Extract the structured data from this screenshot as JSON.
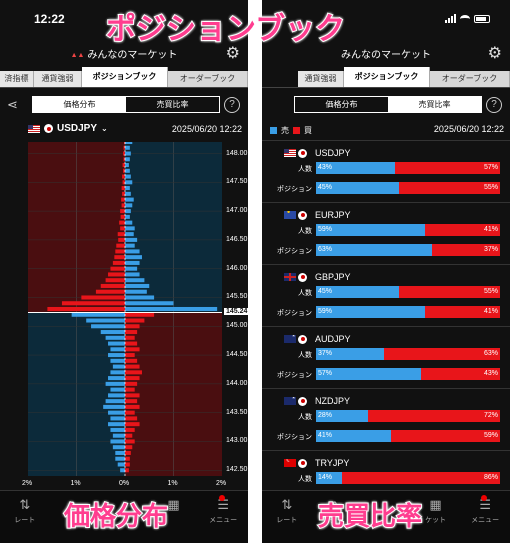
{
  "overlay": {
    "title": "ポジションブック",
    "price_dist": "価格分布",
    "ratio": "売買比率"
  },
  "status": {
    "time": "12:22"
  },
  "app": {
    "title": "みんなのマーケット",
    "icon": "gear-icon"
  },
  "tabs": {
    "left": [
      "済指標",
      "通貨強弱",
      "ポジションブック",
      "オーダーブック"
    ],
    "right": [
      "通貨強弱",
      "ポジションブック",
      "オーダーブック"
    ],
    "active": "ポジションブック"
  },
  "segment": {
    "price": "価格分布",
    "ratio": "売買比率"
  },
  "help": "?",
  "price_view": {
    "pair": "USDJPY",
    "timestamp": "2025/06/20 12:22",
    "current_price": "145.24",
    "x_ticks": [
      "2%",
      "1%",
      "0%",
      "1%",
      "2%"
    ]
  },
  "ratio_view": {
    "timestamp": "2025/06/20 12:22",
    "legend_sell": "売",
    "legend_buy": "買",
    "row_people": "人数",
    "row_position": "ポジション",
    "pairs": [
      {
        "name": "USDJPY",
        "flags": [
          "us",
          "jp"
        ],
        "people": [
          43,
          57
        ],
        "position": [
          45,
          55
        ],
        "people_text": [
          "43%",
          "57%"
        ],
        "position_text": [
          "45%",
          "55%"
        ]
      },
      {
        "name": "EURJPY",
        "flags": [
          "eu",
          "jp"
        ],
        "people": [
          59,
          41
        ],
        "position": [
          63,
          37
        ],
        "people_text": [
          "59%",
          "41%"
        ],
        "position_text": [
          "63%",
          "37%"
        ]
      },
      {
        "name": "GBPJPY",
        "flags": [
          "gb",
          "jp"
        ],
        "people": [
          45,
          55
        ],
        "position": [
          59,
          41
        ],
        "people_text": [
          "45%",
          "55%"
        ],
        "position_text": [
          "59%",
          "41%"
        ]
      },
      {
        "name": "AUDJPY",
        "flags": [
          "au",
          "jp"
        ],
        "people": [
          37,
          63
        ],
        "position": [
          57,
          43
        ],
        "people_text": [
          "37%",
          "63%"
        ],
        "position_text": [
          "57%",
          "43%"
        ]
      },
      {
        "name": "NZDJPY",
        "flags": [
          "nz",
          "jp"
        ],
        "people": [
          28,
          72
        ],
        "position": [
          41,
          59
        ],
        "people_text": [
          "28%",
          "72%"
        ],
        "position_text": [
          "41%",
          "59%"
        ]
      },
      {
        "name": "TRYJPY",
        "flags": [
          "tr",
          "jp"
        ],
        "people": [
          14,
          86
        ],
        "position": [],
        "people_text": [
          "14%",
          "86%"
        ],
        "position_text": []
      }
    ]
  },
  "nav": {
    "left": [
      {
        "icon": "swap-icon",
        "label": "レート"
      },
      {
        "icon": "chart-icon",
        "label": "チャ"
      },
      {
        "icon": "",
        "label": ""
      },
      {
        "icon": "",
        "label": ""
      },
      {
        "icon": "menu-icon",
        "label": "メニュー"
      }
    ],
    "right": [
      {
        "icon": "swap-icon",
        "label": "レート"
      },
      {
        "icon": "chart-icon",
        "label": "チャ"
      },
      {
        "icon": "",
        "label": ""
      },
      {
        "icon": "market-icon",
        "label": "ケット"
      },
      {
        "icon": "menu-icon",
        "label": "メニュー"
      }
    ]
  },
  "colors": {
    "buy": "#3a9ee6",
    "sell": "#e8151a",
    "bg": "#111111",
    "sell_zone": "#4a0e10",
    "buy_zone": "#0c2a3a",
    "accent": "#ff3d8f"
  },
  "chart_data": {
    "type": "bar",
    "orientation": "horizontal",
    "title": "",
    "xlabel": "",
    "ylabel": "",
    "ylim": [
      142.4,
      148.2
    ],
    "xlim": [
      -2,
      2
    ],
    "y_ticks": [
      148.0,
      147.5,
      147.0,
      146.5,
      146.0,
      145.5,
      145.24,
      145.0,
      144.5,
      144.0,
      143.5,
      143.0,
      142.5
    ],
    "current_price": 145.24,
    "series": [
      {
        "side": "left",
        "levels": [
          148.2,
          148.1,
          148.0,
          147.9,
          147.8,
          147.7,
          147.6,
          147.5,
          147.4,
          147.3,
          147.2,
          147.1,
          147.0,
          146.9,
          146.8,
          146.7,
          146.6,
          146.5,
          146.4,
          146.3,
          146.2,
          146.1,
          146.0,
          145.9,
          145.8,
          145.7,
          145.6,
          145.5,
          145.4,
          145.3,
          145.2,
          145.1,
          145.0,
          144.9,
          144.8,
          144.7,
          144.6,
          144.5,
          144.4,
          144.3,
          144.2,
          144.1,
          144.0,
          143.9,
          143.8,
          143.7,
          143.6,
          143.5,
          143.4,
          143.3,
          143.2,
          143.1,
          143.0,
          142.9,
          142.8,
          142.7,
          142.6,
          142.5
        ],
        "values": [
          0.02,
          0.03,
          0.04,
          0.03,
          0.05,
          0.04,
          0.06,
          0.05,
          0.07,
          0.06,
          0.08,
          0.07,
          0.1,
          0.09,
          0.12,
          0.1,
          0.15,
          0.14,
          0.18,
          0.2,
          0.22,
          0.25,
          0.3,
          0.35,
          0.4,
          0.5,
          0.6,
          0.9,
          1.3,
          1.6,
          1.1,
          0.8,
          0.7,
          0.5,
          0.4,
          0.35,
          0.3,
          0.35,
          0.3,
          0.25,
          0.3,
          0.35,
          0.4,
          0.3,
          0.35,
          0.4,
          0.45,
          0.35,
          0.3,
          0.35,
          0.3,
          0.25,
          0.3,
          0.25,
          0.2,
          0.2,
          0.15,
          0.1
        ]
      },
      {
        "side": "right",
        "levels": [
          148.2,
          148.1,
          148.0,
          147.9,
          147.8,
          147.7,
          147.6,
          147.5,
          147.4,
          147.3,
          147.2,
          147.1,
          147.0,
          146.9,
          146.8,
          146.7,
          146.6,
          146.5,
          146.4,
          146.3,
          146.2,
          146.1,
          146.0,
          145.9,
          145.8,
          145.7,
          145.6,
          145.5,
          145.4,
          145.3,
          145.2,
          145.1,
          145.0,
          144.9,
          144.8,
          144.7,
          144.6,
          144.5,
          144.4,
          144.3,
          144.2,
          144.1,
          144.0,
          143.9,
          143.8,
          143.7,
          143.6,
          143.5,
          143.4,
          143.3,
          143.2,
          143.1,
          143.0,
          142.9,
          142.8,
          142.7,
          142.6,
          142.5
        ],
        "values": [
          0.15,
          0.1,
          0.12,
          0.1,
          0.08,
          0.1,
          0.12,
          0.15,
          0.1,
          0.12,
          0.18,
          0.15,
          0.12,
          0.1,
          0.15,
          0.2,
          0.18,
          0.25,
          0.2,
          0.3,
          0.35,
          0.3,
          0.25,
          0.3,
          0.4,
          0.5,
          0.45,
          0.6,
          1.0,
          1.9,
          0.6,
          0.4,
          0.3,
          0.25,
          0.2,
          0.25,
          0.3,
          0.2,
          0.25,
          0.3,
          0.35,
          0.3,
          0.25,
          0.2,
          0.3,
          0.25,
          0.3,
          0.2,
          0.25,
          0.3,
          0.2,
          0.15,
          0.2,
          0.15,
          0.12,
          0.1,
          0.1,
          0.08
        ]
      }
    ]
  }
}
